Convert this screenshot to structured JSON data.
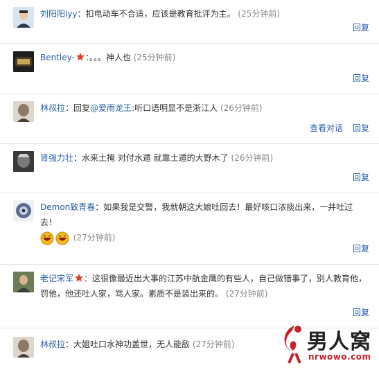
{
  "comments": [
    {
      "user": "刘阳阳lyy",
      "text": "扣电动车不合适，应该是教育批评为主。",
      "time": "(25分钟前)",
      "actions": [
        "回复"
      ]
    },
    {
      "user": "Bentley-",
      "text": "。。。神人也",
      "time": "(25分钟前)",
      "actions": [
        "回复"
      ],
      "badge": "star"
    },
    {
      "user": "林叔拉",
      "text_prefix": "回复",
      "mention": "@爱雨龙王",
      "text": ":听口语明显不是浙江人",
      "time": "(26分钟前)",
      "actions": [
        "查看对话",
        "回复"
      ]
    },
    {
      "user": "肾强力壮",
      "text": "水来土掩 对付水遁 就靠土遁的大野木了",
      "time": "(26分钟前)",
      "actions": [
        "回复"
      ]
    },
    {
      "user": "Demon致青春",
      "text": "如果我是交警，我就朝这大娘吐回去！最好咳口浓痰出来，一并吐过去！",
      "time": "(27分钟前)",
      "actions": [
        "回复"
      ],
      "emoji": true
    },
    {
      "user": "老记宋军",
      "text": "这很像最近出大事的江苏中航金鹰的有些人，自己做错事了，别人教育他，罚他，他还吐人家，骂人家。素质不是装出来的。",
      "time": "(27分钟前)",
      "actions": [
        "回复"
      ],
      "badge": "star"
    },
    {
      "user": "林叔拉",
      "text": "大姐吐口水神功盖世，无人能敌",
      "time": "(27分钟前)",
      "actions": []
    }
  ],
  "watermark": {
    "brand": "男人窝",
    "url": "nrwowo.com"
  }
}
